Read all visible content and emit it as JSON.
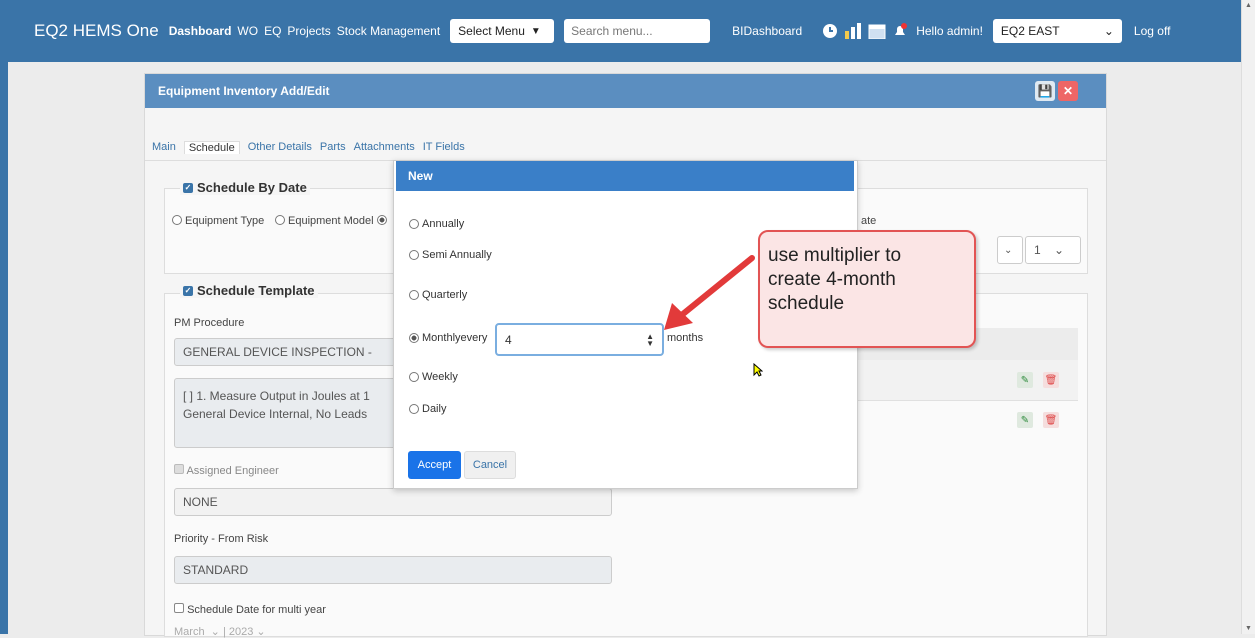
{
  "app": {
    "brand": "EQ2 HEMS One",
    "nav": [
      "Dashboard",
      "WO",
      "EQ",
      "Projects",
      "Stock Management"
    ],
    "select_menu": "Select Menu",
    "search_placeholder": "Search menu...",
    "bi_link": "BIDashboard",
    "greeting": "Hello admin!",
    "region": "EQ2 EAST",
    "logoff": "Log off"
  },
  "panel": {
    "title": "Equipment Inventory Add/Edit",
    "tabs": [
      "Main",
      "Schedule",
      "Other Details",
      "Parts",
      "Attachments",
      "IT Fields"
    ],
    "active_tab": "Schedule",
    "schedule_by_date": {
      "legend": "Schedule By Date",
      "options": [
        "Equipment Type",
        "Equipment Model"
      ],
      "right_label": "ate",
      "right_select": "1"
    },
    "schedule_template": {
      "legend": "Schedule Template",
      "pm_label": "PM Procedure",
      "pm_value": "GENERAL DEVICE INSPECTION -",
      "steps_line1": "[ ] 1. Measure Output in Joules at 1",
      "steps_line2": "General Device Internal, No Leads",
      "assigned_label": "Assigned Engineer",
      "assigned_value": "NONE",
      "priority_label": "Priority - From Risk",
      "priority_value": "STANDARD",
      "multi_year_label": "Schedule Date for multi year",
      "month": "March",
      "year": "2023"
    }
  },
  "modal": {
    "title": "New",
    "options": {
      "annually": "Annually",
      "semi": "Semi Annually",
      "quarterly": "Quarterly",
      "monthly": "Monthlyevery",
      "weekly": "Weekly",
      "daily": "Daily"
    },
    "selected": "Monthly",
    "every_value": "4",
    "months_label": "months",
    "accept": "Accept",
    "cancel": "Cancel"
  },
  "callout": {
    "text": "use multiplier to\ncreate 4-month\nschedule",
    "color": "#e25454"
  }
}
